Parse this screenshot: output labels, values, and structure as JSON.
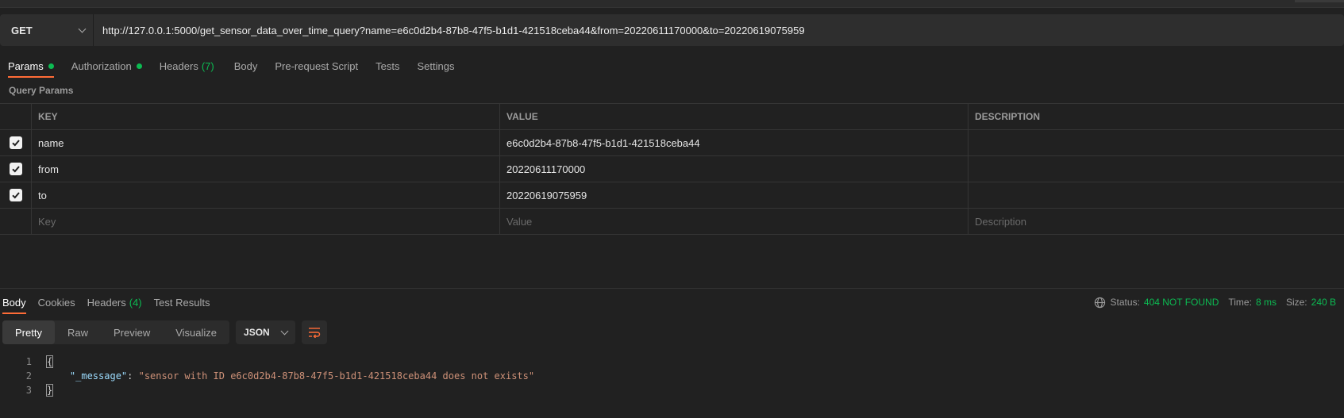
{
  "request": {
    "method": "GET",
    "url": "http://127.0.0.1:5000/get_sensor_data_over_time_query?name=e6c0d2b4-87b8-47f5-b1d1-421518ceba44&from=20220611170000&to=20220619075959"
  },
  "request_tabs": {
    "params": "Params",
    "authorization": "Authorization",
    "headers": "Headers",
    "headers_count": "(7)",
    "body": "Body",
    "prerequest": "Pre-request Script",
    "tests": "Tests",
    "settings": "Settings"
  },
  "query_params": {
    "title": "Query Params",
    "columns": {
      "key": "KEY",
      "value": "VALUE",
      "description": "DESCRIPTION"
    },
    "rows": [
      {
        "key": "name",
        "value": "e6c0d2b4-87b8-47f5-b1d1-421518ceba44",
        "description": ""
      },
      {
        "key": "from",
        "value": "20220611170000",
        "description": ""
      },
      {
        "key": "to",
        "value": "20220619075959",
        "description": ""
      }
    ],
    "placeholders": {
      "key": "Key",
      "value": "Value",
      "description": "Description"
    }
  },
  "response_tabs": {
    "body": "Body",
    "cookies": "Cookies",
    "headers": "Headers",
    "headers_count": "(4)",
    "test_results": "Test Results"
  },
  "response_status": {
    "status_label": "Status:",
    "status_value": "404 NOT FOUND",
    "time_label": "Time:",
    "time_value": "8 ms",
    "size_label": "Size:",
    "size_value": "240 B"
  },
  "view": {
    "modes": [
      "Pretty",
      "Raw",
      "Preview",
      "Visualize"
    ],
    "active_mode": "Pretty",
    "format": "JSON"
  },
  "response_body": {
    "line_numbers": [
      "1",
      "2",
      "3"
    ],
    "open_brace": "{",
    "close_brace": "}",
    "key": "\"_message\"",
    "colon": ": ",
    "value": "\"sensor with ID e6c0d2b4-87b8-47f5-b1d1-421518ceba44 does not exists\""
  },
  "colors": {
    "accent": "#ff6c37",
    "success": "#0cbb52",
    "background": "#212121"
  }
}
